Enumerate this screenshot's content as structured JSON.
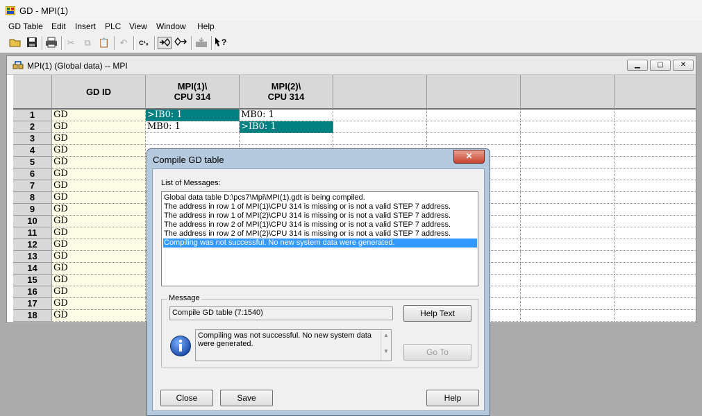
{
  "window": {
    "title": "GD - MPI(1)"
  },
  "menu": [
    "GD Table",
    "Edit",
    "Insert",
    "PLC",
    "View",
    "Window",
    "Help"
  ],
  "toolbar": {
    "icons": [
      "open-icon",
      "save-icon",
      "print-icon",
      "cut-icon",
      "copy-icon",
      "paste-icon",
      "undo-icon",
      "compile-icon",
      "download-icon",
      "upload-icon",
      "status-icon",
      "help-icon"
    ],
    "glyphs": {
      "compile": "C¹₀",
      "help": "⚲?"
    }
  },
  "child": {
    "title": "MPI(1) (Global data) -- MPI"
  },
  "table": {
    "headers": [
      "GD ID",
      "MPI(1)\\\nCPU 314",
      "MPI(2)\\\nCPU 314",
      "",
      "",
      "",
      ""
    ],
    "header_line1": [
      "GD ID",
      "MPI(1)\\",
      "MPI(2)\\"
    ],
    "header_line2": [
      "",
      "CPU 314",
      "CPU 314"
    ],
    "rows": [
      {
        "num": "1",
        "gdid": "GD",
        "c1": ">IB0: 1",
        "c2": "MB0: 1"
      },
      {
        "num": "2",
        "gdid": "GD",
        "c1": "MB0: 1",
        "c2": ">IB0: 1"
      },
      {
        "num": "3",
        "gdid": "GD",
        "c1": "",
        "c2": ""
      },
      {
        "num": "4",
        "gdid": "GD",
        "c1": "",
        "c2": ""
      },
      {
        "num": "5",
        "gdid": "GD",
        "c1": "",
        "c2": ""
      },
      {
        "num": "6",
        "gdid": "GD",
        "c1": "",
        "c2": ""
      },
      {
        "num": "7",
        "gdid": "GD",
        "c1": "",
        "c2": ""
      },
      {
        "num": "8",
        "gdid": "GD",
        "c1": "",
        "c2": ""
      },
      {
        "num": "9",
        "gdid": "GD",
        "c1": "",
        "c2": ""
      },
      {
        "num": "10",
        "gdid": "GD",
        "c1": "",
        "c2": ""
      },
      {
        "num": "11",
        "gdid": "GD",
        "c1": "",
        "c2": ""
      },
      {
        "num": "12",
        "gdid": "GD",
        "c1": "",
        "c2": ""
      },
      {
        "num": "13",
        "gdid": "GD",
        "c1": "",
        "c2": ""
      },
      {
        "num": "14",
        "gdid": "GD",
        "c1": "",
        "c2": ""
      },
      {
        "num": "15",
        "gdid": "GD",
        "c1": "",
        "c2": ""
      },
      {
        "num": "16",
        "gdid": "GD",
        "c1": "",
        "c2": ""
      },
      {
        "num": "17",
        "gdid": "GD",
        "c1": "",
        "c2": ""
      },
      {
        "num": "18",
        "gdid": "GD",
        "c1": "",
        "c2": ""
      }
    ]
  },
  "dialog": {
    "title": "Compile GD table",
    "close_glyph": "✕",
    "list_label": "List of Messages:",
    "messages": [
      "Global data table D:\\pcs7\\Mpi\\MPI(1).gdt is being compiled.",
      "The address in row 1 of MPI(1)\\CPU 314 is missing or is not a valid STEP 7 address.",
      "The address in row 1 of MPI(2)\\CPU 314 is missing or is not a valid STEP 7 address.",
      "The address in row 2 of MPI(1)\\CPU 314 is missing or is not a valid STEP 7 address.",
      "The address in row 2 of MPI(2)\\CPU 314 is missing or is not a valid STEP 7 address.",
      "Compiling was not successful. No new system data were generated."
    ],
    "group_label": "Message",
    "message_code": "Compile GD table (7:1540)",
    "message_text": "Compiling was not successful. No new system data were generated.",
    "help_text_button": "Help Text",
    "goto_button": "Go To",
    "close_button": "Close",
    "save_button": "Save",
    "help_button": "Help"
  },
  "colors": {
    "selection": "#008080",
    "highlight": "#3399ff",
    "gdid_bg": "#fbfbe6"
  }
}
